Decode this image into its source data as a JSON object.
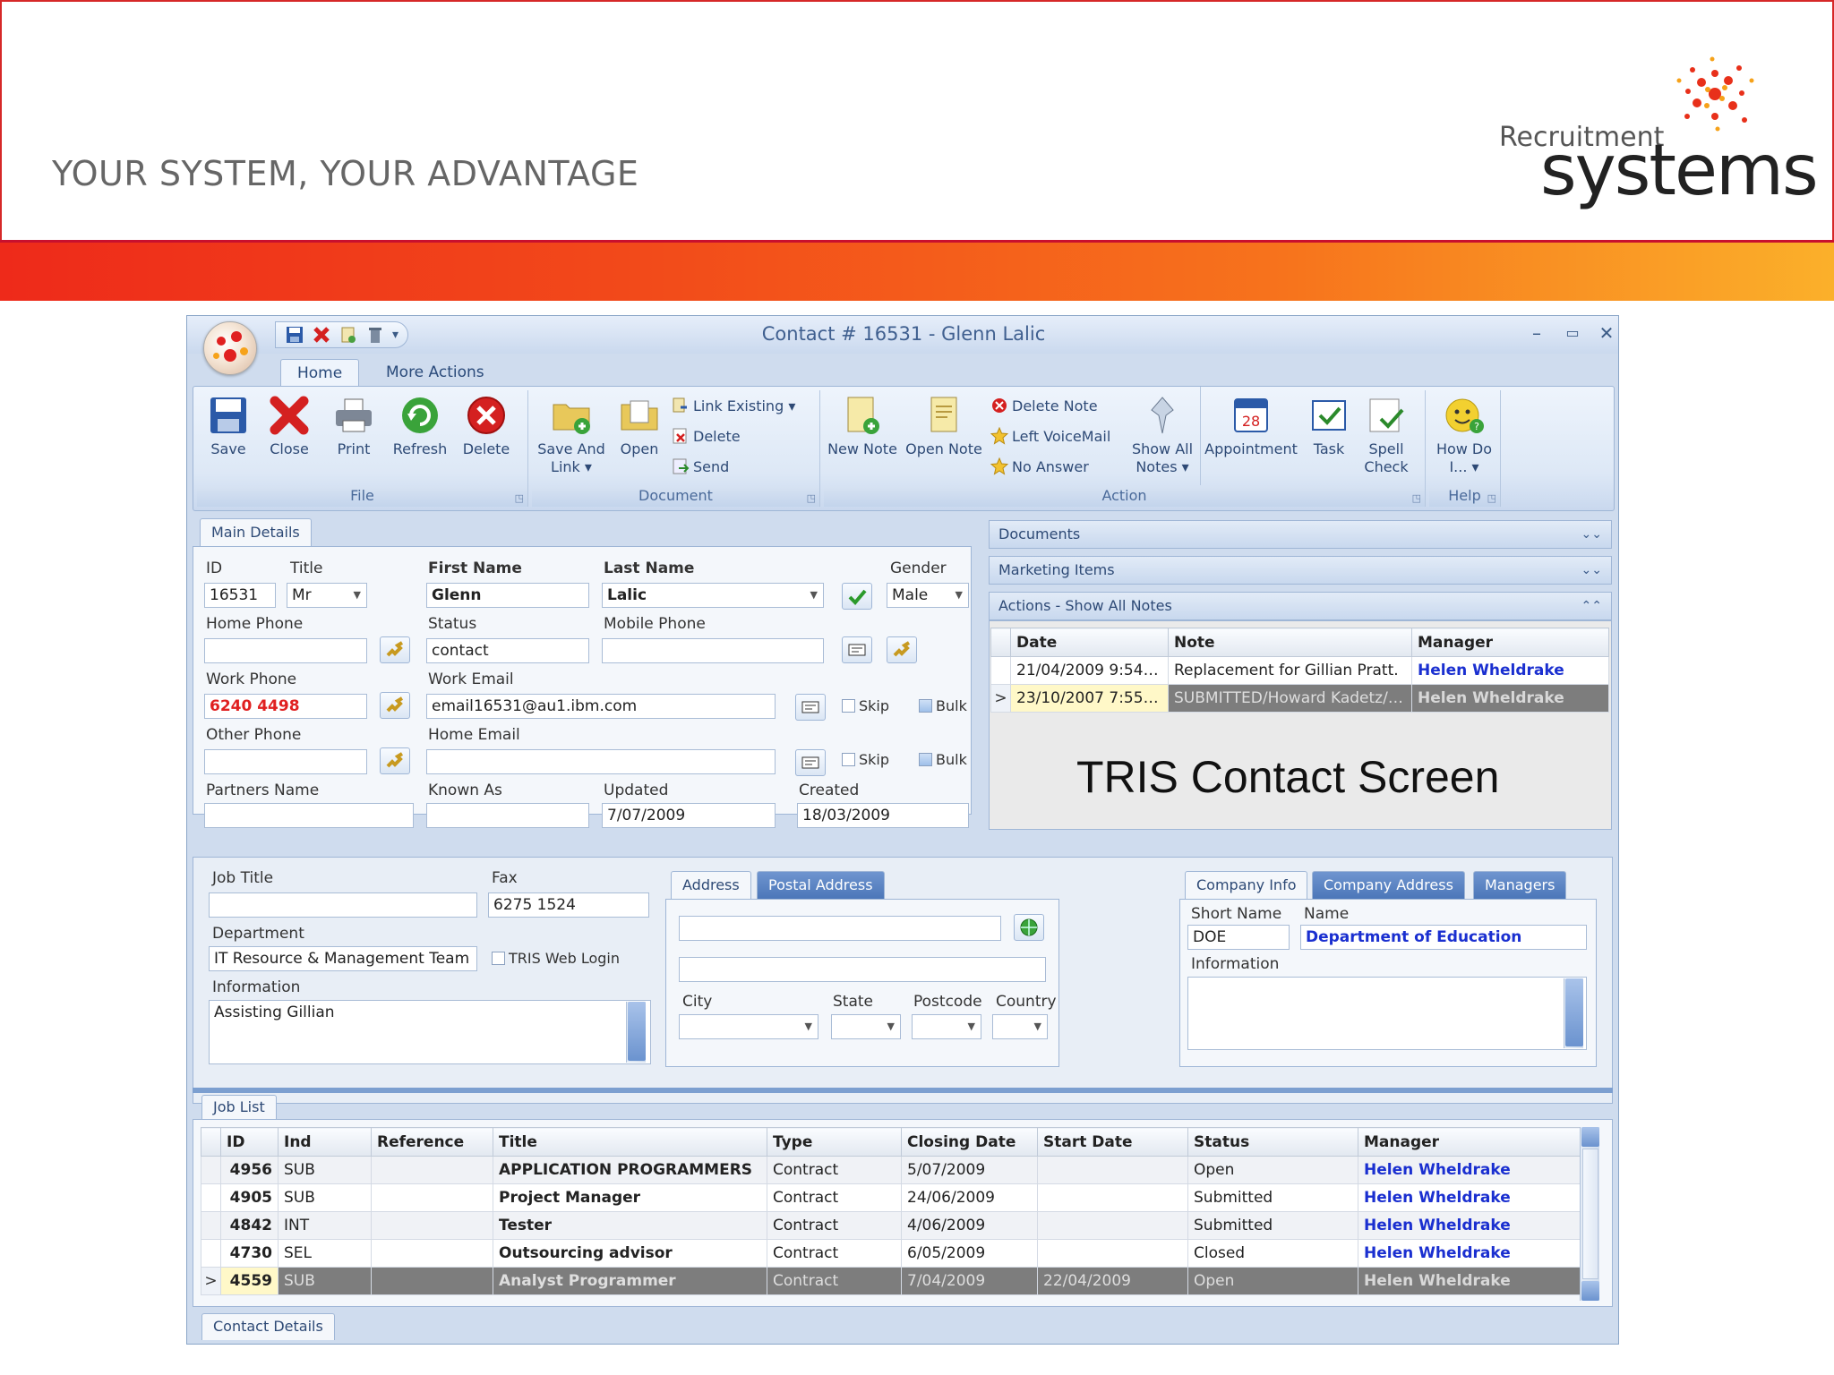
{
  "slide": {
    "tagline": "YOUR SYSTEM, YOUR ADVANTAGE",
    "logo_small": "Recruitment",
    "logo_big": "systems"
  },
  "window": {
    "title": "Contact # 16531 - Glenn Lalic",
    "min": "–",
    "max": "▭",
    "close": "✕",
    "qat_more": "▾"
  },
  "ribbon_tabs": [
    "Home",
    "More Actions"
  ],
  "ribbon": {
    "groups": [
      "File",
      "Document",
      "Action",
      "Help"
    ],
    "save": "Save",
    "close": "Close",
    "print": "Print",
    "refresh": "Refresh",
    "delete": "Delete",
    "save_and_link": "Save And",
    "save_and_link_2": "Link ▾",
    "open": "Open",
    "link_existing": "Link Existing ▾",
    "doc_delete": "Delete",
    "send": "Send",
    "new_note": "New Note",
    "open_note": "Open Note",
    "delete_note": "Delete Note",
    "left_voicemail": "Left VoiceMail",
    "no_answer": "No Answer",
    "show_all_notes": "Show All",
    "show_all_notes_2": "Notes ▾",
    "appointment": "Appointment",
    "task": "Task",
    "spell_check": "Spell",
    "spell_check_2": "Check",
    "how_do_i": "How Do",
    "how_do_i_2": "I... ▾"
  },
  "main_details": {
    "tab": "Main Details",
    "id_label": "ID",
    "id": "16531",
    "title_label": "Title",
    "title": "Mr",
    "first_name_label": "First Name",
    "first_name": "Glenn",
    "last_name_label": "Last Name",
    "last_name": "Lalic",
    "gender_label": "Gender",
    "gender": "Male",
    "home_phone_label": "Home Phone",
    "home_phone": "",
    "status_label": "Status",
    "status": "contact",
    "mobile_phone_label": "Mobile Phone",
    "mobile_phone": "",
    "work_phone_label": "Work Phone",
    "work_phone": "6240 4498",
    "work_email_label": "Work Email",
    "work_email": "email16531@au1.ibm.com",
    "other_phone_label": "Other Phone",
    "other_phone": "",
    "home_email_label": "Home Email",
    "home_email": "",
    "skip": "Skip",
    "bulk": "Bulk",
    "partners_name_label": "Partners Name",
    "partners_name": "",
    "known_as_label": "Known As",
    "known_as": "",
    "updated_label": "Updated",
    "updated": "7/07/2009",
    "created_label": "Created",
    "created": "18/03/2009"
  },
  "right_sections": {
    "documents": "Documents",
    "marketing_items": "Marketing Items",
    "actions": "Actions - Show All Notes",
    "notes_headers": [
      "Date",
      "Note",
      "Manager"
    ],
    "notes_rows": [
      {
        "date": "21/04/2009 9:54:2...",
        "note": "Replacement for Gillian Pratt.",
        "manager": "Helen Wheldrake"
      },
      {
        "date": "23/10/2007 7:55:0...",
        "note": "SUBMITTED/Howard Kadetz/1...",
        "manager": "Helen Wheldrake"
      }
    ],
    "selected_marker": ">"
  },
  "caption": "TRIS Contact Screen",
  "job_panel": {
    "job_title_label": "Job Title",
    "job_title": "",
    "fax_label": "Fax",
    "fax": "6275 1524",
    "department_label": "Department",
    "department": "IT Resource & Management Team",
    "tris_web_login": "TRIS Web Login",
    "information_label": "Information",
    "information": "Assisting Gillian"
  },
  "address_panel": {
    "tabs": [
      "Address",
      "Postal Address"
    ],
    "line1": "",
    "line2": "",
    "city_label": "City",
    "state_label": "State",
    "postcode_label": "Postcode",
    "country_label": "Country"
  },
  "company_panel": {
    "tabs": [
      "Company Info",
      "Company Address",
      "Managers"
    ],
    "short_name_label": "Short Name",
    "short_name": "DOE",
    "name_label": "Name",
    "name": "Department of Education",
    "information_label": "Information"
  },
  "job_list": {
    "tab": "Job List",
    "headers": [
      "ID",
      "Ind",
      "Reference",
      "Title",
      "Type",
      "Closing Date",
      "Start Date",
      "Status",
      "Manager"
    ],
    "rows": [
      {
        "id": "4956",
        "ind": "SUB",
        "reference": "",
        "title": "APPLICATION PROGRAMMERS",
        "type": "Contract",
        "closing": "5/07/2009",
        "start": "",
        "status": "Open",
        "manager": "Helen Wheldrake"
      },
      {
        "id": "4905",
        "ind": "SUB",
        "reference": "",
        "title": "Project Manager",
        "type": "Contract",
        "closing": "24/06/2009",
        "start": "",
        "status": "Submitted",
        "manager": "Helen Wheldrake"
      },
      {
        "id": "4842",
        "ind": "INT",
        "reference": "",
        "title": "Tester",
        "type": "Contract",
        "closing": "4/06/2009",
        "start": "",
        "status": "Submitted",
        "manager": "Helen Wheldrake"
      },
      {
        "id": "4730",
        "ind": "SEL",
        "reference": "",
        "title": "Outsourcing advisor",
        "type": "Contract",
        "closing": "6/05/2009",
        "start": "",
        "status": "Closed",
        "manager": "Helen Wheldrake"
      },
      {
        "id": "4559",
        "ind": "SUB",
        "reference": "",
        "title": "Analyst Programmer",
        "type": "Contract",
        "closing": "7/04/2009",
        "start": "22/04/2009",
        "status": "Open",
        "manager": "Helen Wheldrake"
      }
    ],
    "selected_marker": ">"
  },
  "bottom_tab": "Contact Details",
  "colors": {
    "accent": "#e02020",
    "link": "#1a2fd0",
    "ribbon": "#dde8f6"
  }
}
